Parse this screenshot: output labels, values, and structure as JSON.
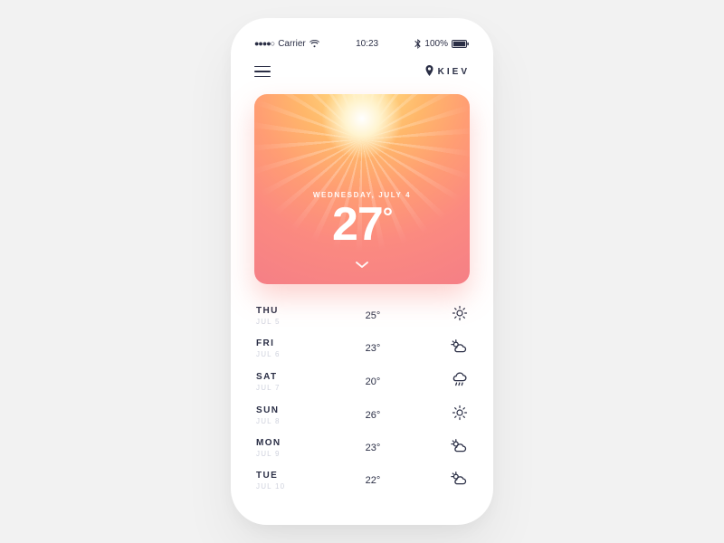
{
  "status": {
    "signal_dots": "●●●●○",
    "carrier": "Carrier",
    "time": "10:23",
    "battery": "100%"
  },
  "nav": {
    "location": "KIEV"
  },
  "hero": {
    "date_label": "WEDNESDAY, JULY 4",
    "temperature": "27",
    "degree_symbol": "°"
  },
  "forecast": [
    {
      "day": "THU",
      "date": "JUL 5",
      "temp": "25°",
      "icon": "sun"
    },
    {
      "day": "FRI",
      "date": "JUL 6",
      "temp": "23°",
      "icon": "partly-cloudy"
    },
    {
      "day": "SAT",
      "date": "JUL 7",
      "temp": "20°",
      "icon": "rain"
    },
    {
      "day": "SUN",
      "date": "JUL 8",
      "temp": "26°",
      "icon": "sun"
    },
    {
      "day": "MON",
      "date": "JUL 9",
      "temp": "23°",
      "icon": "partly-cloudy"
    },
    {
      "day": "TUE",
      "date": "JUL 10",
      "temp": "22°",
      "icon": "partly-cloudy"
    }
  ]
}
